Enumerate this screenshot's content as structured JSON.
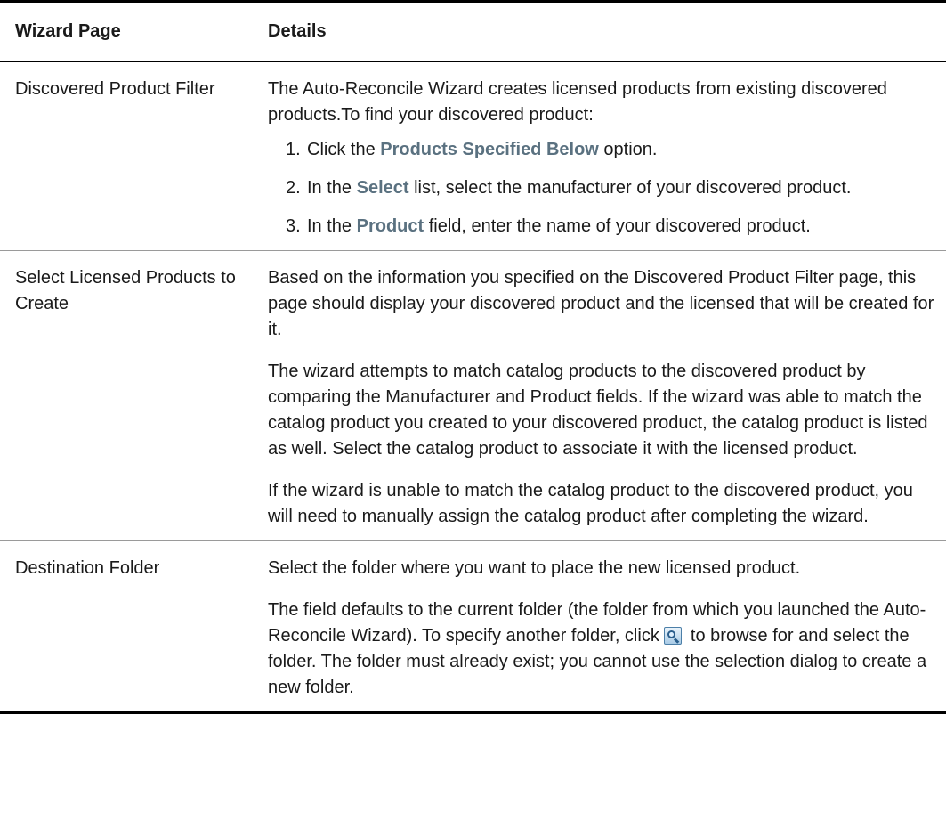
{
  "header": {
    "col1": "Wizard Page",
    "col2": "Details"
  },
  "rows": [
    {
      "page": "Discovered Product Filter",
      "intro": "The Auto-Reconcile Wizard creates licensed products from existing discovered products.To find your discovered product:",
      "steps": [
        {
          "num": "1.",
          "pre": "Click the ",
          "ui": "Products Specified Below",
          "post": " option."
        },
        {
          "num": "2.",
          "pre": "In the ",
          "ui": "Select",
          "post": " list, select the manufacturer of your discovered product."
        },
        {
          "num": "3.",
          "pre": "In the ",
          "ui": "Product",
          "post": " field, enter the name of your discovered product."
        }
      ]
    },
    {
      "page": "Select Licensed Products to Create",
      "paragraphs": [
        "Based on the information you specified on the Discovered Product Filter page, this page should display your discovered product and the licensed that will be created for it.",
        "The wizard attempts to match catalog products to the discovered product by comparing the Manufacturer and Product fields. If the wizard was able to match the catalog product you created to your discovered product, the catalog product is listed as well. Select the catalog product to associate it with the licensed product.",
        "If the wizard is unable to match the catalog product to the discovered product, you will need to manually assign the catalog product after completing the wizard."
      ]
    },
    {
      "page": "Destination Folder",
      "paragraphs": [
        "Select the folder where you want to place the new licensed product."
      ],
      "browse_para": {
        "pre": "The field defaults to the current folder (the folder from which you launched the Auto-Reconcile Wizard). To specify another folder, click ",
        "icon": "browse-magnifier-icon",
        "post": " to browse for and select the folder. The folder must already exist; you cannot use the selection dialog to create a new folder."
      }
    }
  ]
}
